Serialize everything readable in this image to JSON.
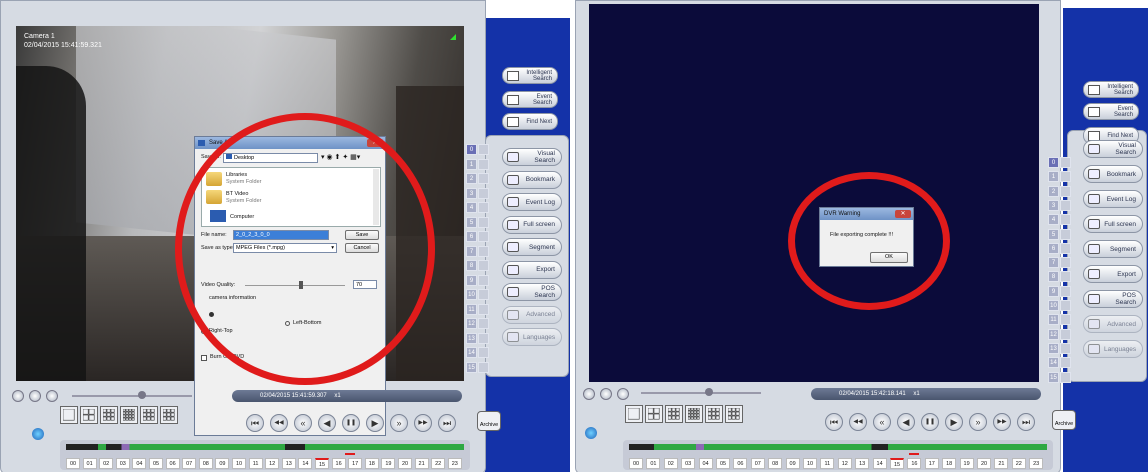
{
  "left": {
    "camera_label": "Camera 1",
    "camera_timestamp": "02/04/2015 15:41:59.321",
    "playback_time": "02/04/2015 15:41:59.307",
    "playback_speed": "x1",
    "save_dialog": {
      "title": "Save As",
      "save_in_label": "Save in:",
      "save_in_value": "Desktop",
      "items": [
        {
          "name": "Libraries",
          "sub": "System Folder"
        },
        {
          "name": "BT Video",
          "sub": "System Folder"
        },
        {
          "name": "Computer",
          "sub": ""
        }
      ],
      "file_name_label": "File name:",
      "file_name_value": "2_0_2_3_0_0",
      "save_type_label": "Save as type:",
      "save_type_value": "MPEG Files (*.mpg)",
      "save_button": "Save",
      "cancel_button": "Cancel",
      "video_quality_label": "Video Quality:",
      "video_quality_value": "70",
      "camera_info_label": "camera information",
      "left_bottom_label": "Left-Bottom",
      "right_top_label": "Right-Top",
      "burn_label": "Burn CD/DVD"
    }
  },
  "right": {
    "playback_time": "02/04/2015 15:42:18.141",
    "playback_speed": "x1",
    "warning_dialog": {
      "title": "DVR Warning",
      "message": "File exporting complete !!!",
      "ok_button": "OK"
    }
  },
  "top_buttons": [
    {
      "label": "Intelligent Search",
      "icon": "intelligent-search-icon"
    },
    {
      "label": "Event Search",
      "icon": "event-search-icon"
    },
    {
      "label": "Find Next",
      "icon": "find-next-icon"
    }
  ],
  "side_buttons": [
    {
      "label": "Visual Search",
      "icon": "visual-search-icon"
    },
    {
      "label": "Bookmark",
      "icon": "bookmark-icon"
    },
    {
      "label": "Event Log",
      "icon": "event-log-icon"
    },
    {
      "label": "Full screen",
      "icon": "fullscreen-icon"
    },
    {
      "label": "Segment",
      "icon": "segment-icon"
    },
    {
      "label": "Export",
      "icon": "export-icon"
    },
    {
      "label": "POS Search",
      "icon": "pos-search-icon"
    },
    {
      "label": "Advanced",
      "icon": "advanced-icon"
    },
    {
      "label": "Languages",
      "icon": "languages-icon"
    }
  ],
  "channels": [
    "0",
    "1",
    "2",
    "3",
    "4",
    "5",
    "6",
    "7",
    "8",
    "9",
    "10",
    "11",
    "12",
    "13",
    "14",
    "15"
  ],
  "hours": [
    "00",
    "01",
    "02",
    "03",
    "04",
    "05",
    "06",
    "07",
    "08",
    "09",
    "10",
    "11",
    "12",
    "13",
    "14",
    "15",
    "16",
    "17",
    "18",
    "19",
    "20",
    "21",
    "22",
    "23"
  ],
  "archive_label": "Archive",
  "colors": {
    "highlight_ring": "#e01b1b",
    "side_blue": "#1432a8",
    "video_dark": "#0b0b3a"
  }
}
